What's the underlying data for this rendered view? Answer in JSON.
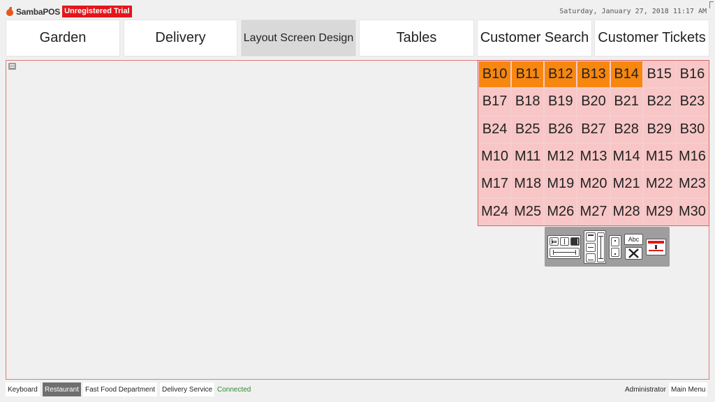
{
  "app": {
    "brand": "SambaPOS",
    "badge": "Unregistered Trial",
    "datetime": "Saturday, January 27, 2018 11:17 AM"
  },
  "nav": {
    "tabs": [
      {
        "label": "Garden"
      },
      {
        "label": "Delivery"
      },
      {
        "label": "Layout Screen Design"
      },
      {
        "label": "Tables"
      },
      {
        "label": "Customer Search"
      },
      {
        "label": "Customer Tickets"
      }
    ],
    "active_index": 2
  },
  "tables": [
    {
      "label": "B10",
      "status": "busy"
    },
    {
      "label": "B11",
      "status": "busy"
    },
    {
      "label": "B12",
      "status": "busy"
    },
    {
      "label": "B13",
      "status": "busy"
    },
    {
      "label": "B14",
      "status": "busy"
    },
    {
      "label": "B15",
      "status": "free"
    },
    {
      "label": "B16",
      "status": "free"
    },
    {
      "label": "B17",
      "status": "free"
    },
    {
      "label": "B18",
      "status": "free"
    },
    {
      "label": "B19",
      "status": "free"
    },
    {
      "label": "B20",
      "status": "free"
    },
    {
      "label": "B21",
      "status": "free"
    },
    {
      "label": "B22",
      "status": "free"
    },
    {
      "label": "B23",
      "status": "free"
    },
    {
      "label": "B24",
      "status": "free"
    },
    {
      "label": "B25",
      "status": "free"
    },
    {
      "label": "B26",
      "status": "free"
    },
    {
      "label": "B27",
      "status": "free"
    },
    {
      "label": "B28",
      "status": "free"
    },
    {
      "label": "B29",
      "status": "free"
    },
    {
      "label": "B30",
      "status": "free"
    },
    {
      "label": "M10",
      "status": "free"
    },
    {
      "label": "M11",
      "status": "free"
    },
    {
      "label": "M12",
      "status": "free"
    },
    {
      "label": "M13",
      "status": "free"
    },
    {
      "label": "M14",
      "status": "free"
    },
    {
      "label": "M15",
      "status": "free"
    },
    {
      "label": "M16",
      "status": "free"
    },
    {
      "label": "M17",
      "status": "free"
    },
    {
      "label": "M18",
      "status": "free"
    },
    {
      "label": "M19",
      "status": "free"
    },
    {
      "label": "M20",
      "status": "free"
    },
    {
      "label": "M21",
      "status": "free"
    },
    {
      "label": "M22",
      "status": "free"
    },
    {
      "label": "M23",
      "status": "free"
    },
    {
      "label": "M24",
      "status": "free"
    },
    {
      "label": "M25",
      "status": "free"
    },
    {
      "label": "M26",
      "status": "free"
    },
    {
      "label": "M27",
      "status": "free"
    },
    {
      "label": "M28",
      "status": "free"
    },
    {
      "label": "M29",
      "status": "free"
    },
    {
      "label": "M30",
      "status": "free"
    }
  ],
  "toolbox": {
    "text_button": "Abc"
  },
  "colors": {
    "busy": "#f7870f",
    "free": "#f8c6c6",
    "brand": "#e3161b",
    "connected": "#2e8b2e"
  },
  "statusbar": {
    "keyboard": "Keyboard",
    "restaurant": "Restaurant",
    "fast_food": "Fast Food Department",
    "delivery_service": "Delivery Service",
    "connection": "Connected",
    "user": "Administrator",
    "main_menu": "Main Menu"
  }
}
